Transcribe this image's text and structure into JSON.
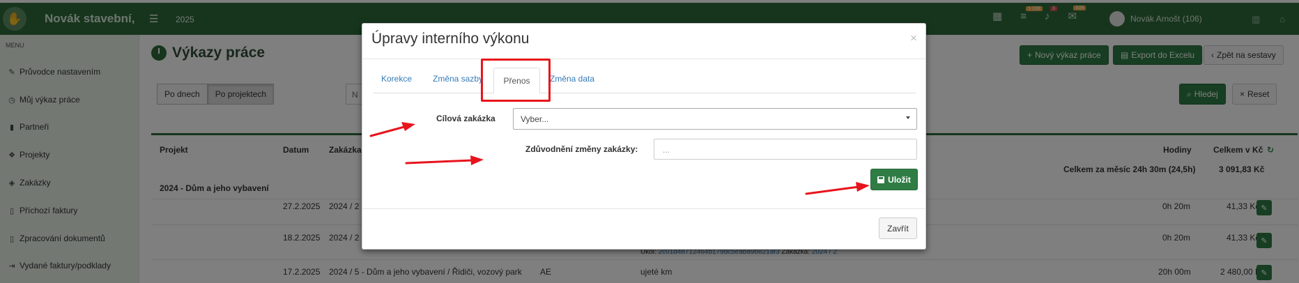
{
  "app": {
    "brand": "Novák stavební,",
    "year": "2025",
    "badges": [
      "1 239",
      "3",
      "928"
    ],
    "user": "Novák Arnošt (106)"
  },
  "sidebar": {
    "menu_label": "MENU",
    "items": [
      {
        "label": "Průvodce nastavením",
        "icon": "pencil-icon"
      },
      {
        "label": "Můj výkaz práce",
        "icon": "clock-icon"
      },
      {
        "label": "Partneři",
        "icon": "building-icon"
      },
      {
        "label": "Projekty",
        "icon": "cubes-icon"
      },
      {
        "label": "Zakázky",
        "icon": "box-icon"
      },
      {
        "label": "Příchozí faktury",
        "icon": "file-icon"
      },
      {
        "label": "Zpracování dokumentů",
        "icon": "file-icon"
      },
      {
        "label": "Vydané faktury/podklady",
        "icon": "export-icon"
      }
    ]
  },
  "page": {
    "title": "Výkazy práce",
    "btn_new": "Nový výkaz práce",
    "btn_export": "Export do Excelu",
    "btn_back": "Zpět na sestavy",
    "seg": [
      "Po dnech",
      "Po projektech"
    ],
    "search_partial": "N",
    "btn_search": "Hledej",
    "btn_reset": "Reset"
  },
  "table": {
    "headers": {
      "projekt": "Projekt",
      "datum": "Datum",
      "zakazka": "Zakázka",
      "hodiny": "Hodiny",
      "celkem": "Celkem v Kč"
    },
    "summary": "Celkem za měsíc 24h 30m (24,5h)",
    "summary_total": "3 091,83 Kč",
    "group": "2024 - Dům a jeho vybavení",
    "rows": [
      {
        "datum": "27.2.2025",
        "zakazka": "2024 / 2 -",
        "hodiny": "0h 20m",
        "celkem": "41,33 Kč"
      },
      {
        "datum": "18.2.2025",
        "zakazka": "2024 / 2 -",
        "hodiny": "0h 20m",
        "celkem": "41,33 Kč"
      },
      {
        "datum": "17.2.2025",
        "zakazka": "2024 / 5 - Dům a jeho vybavení / Řidiči, vozový park",
        "code": "AE",
        "popis": "ujeté km",
        "hodiny": "20h 00m",
        "celkem": "2 480,00 Kč"
      }
    ],
    "ukol_label": "Úkol:",
    "ukol_id": "2c01d48712464b179dc5eaba9b821af3",
    "ukol_zakazka_label": "Zakázka:",
    "ukol_zakazka": "2024 / 2"
  },
  "modal": {
    "title": "Úpravy interního výkonu",
    "close_symbol": "×",
    "tabs": [
      "Korekce",
      "Změna sazby",
      "Přenos",
      "Změna data"
    ],
    "active_tab": "Přenos",
    "field1_label": "Cílová zakázka",
    "field1_value": "Vyber...",
    "field2_label": "Zdůvodnění změny zakázky:",
    "field2_placeholder": "...",
    "save": "Uložit",
    "close": "Zavřít"
  },
  "colors": {
    "brand": "#2f6b3b",
    "primary_button": "#2f7d44",
    "link": "#337ab7",
    "annotation": "#e8141c"
  }
}
